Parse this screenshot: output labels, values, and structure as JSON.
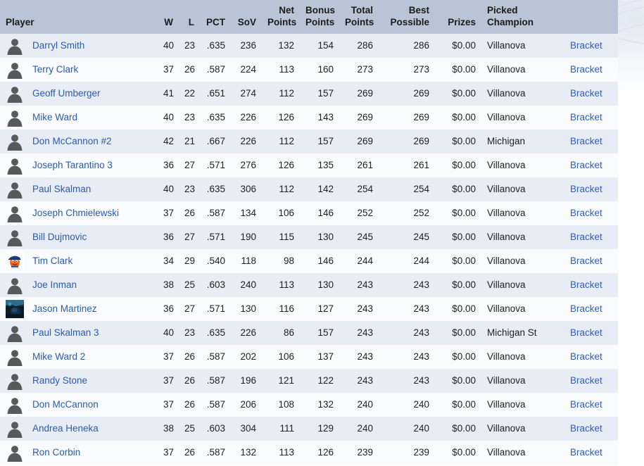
{
  "table": {
    "columns": [
      {
        "key": "player",
        "label": "Player",
        "align": "left"
      },
      {
        "key": "w",
        "label": "W",
        "align": "right"
      },
      {
        "key": "l",
        "label": "L",
        "align": "right"
      },
      {
        "key": "pct",
        "label": "PCT",
        "align": "right"
      },
      {
        "key": "sov",
        "label": "SoV",
        "align": "right"
      },
      {
        "key": "net_points",
        "label": "Net Points",
        "align": "right"
      },
      {
        "key": "bonus_points",
        "label": "Bonus Points",
        "align": "right"
      },
      {
        "key": "total_points",
        "label": "Total Points",
        "align": "right"
      },
      {
        "key": "best_possible",
        "label": "Best Possible",
        "align": "right"
      },
      {
        "key": "prizes",
        "label": "Prizes",
        "align": "right"
      },
      {
        "key": "picked_champion",
        "label": "Picked Champion",
        "align": "left"
      },
      {
        "key": "bracket",
        "label": "",
        "align": "left"
      }
    ],
    "bracket_link_label": "Bracket",
    "rows": [
      {
        "avatar": "default-avatar-icon",
        "player": "Darryl Smith",
        "w": "40",
        "l": "23",
        "pct": ".635",
        "sov": "236",
        "net_points": "132",
        "bonus_points": "154",
        "total_points": "286",
        "best_possible": "286",
        "prizes": "$0.00",
        "picked_champion": "Villanova",
        "bracket": "Bracket"
      },
      {
        "avatar": "default-avatar-icon",
        "player": "Terry Clark",
        "w": "37",
        "l": "26",
        "pct": ".587",
        "sov": "224",
        "net_points": "113",
        "bonus_points": "160",
        "total_points": "273",
        "best_possible": "273",
        "prizes": "$0.00",
        "picked_champion": "Villanova",
        "bracket": "Bracket"
      },
      {
        "avatar": "default-avatar-icon",
        "player": "Geoff Umberger",
        "w": "41",
        "l": "22",
        "pct": ".651",
        "sov": "274",
        "net_points": "112",
        "bonus_points": "157",
        "total_points": "269",
        "best_possible": "269",
        "prizes": "$0.00",
        "picked_champion": "Villanova",
        "bracket": "Bracket"
      },
      {
        "avatar": "default-avatar-icon",
        "player": "Mike Ward",
        "w": "40",
        "l": "23",
        "pct": ".635",
        "sov": "226",
        "net_points": "126",
        "bonus_points": "143",
        "total_points": "269",
        "best_possible": "269",
        "prizes": "$0.00",
        "picked_champion": "Villanova",
        "bracket": "Bracket"
      },
      {
        "avatar": "default-avatar-icon",
        "player": "Don McCannon #2",
        "w": "42",
        "l": "21",
        "pct": ".667",
        "sov": "226",
        "net_points": "112",
        "bonus_points": "157",
        "total_points": "269",
        "best_possible": "269",
        "prizes": "$0.00",
        "picked_champion": "Michigan",
        "bracket": "Bracket"
      },
      {
        "avatar": "default-avatar-icon",
        "player": "Joseph Tarantino 3",
        "w": "36",
        "l": "27",
        "pct": ".571",
        "sov": "276",
        "net_points": "126",
        "bonus_points": "135",
        "total_points": "261",
        "best_possible": "261",
        "prizes": "$0.00",
        "picked_champion": "Villanova",
        "bracket": "Bracket"
      },
      {
        "avatar": "default-avatar-icon",
        "player": "Paul Skalman",
        "w": "40",
        "l": "23",
        "pct": ".635",
        "sov": "306",
        "net_points": "112",
        "bonus_points": "142",
        "total_points": "254",
        "best_possible": "254",
        "prizes": "$0.00",
        "picked_champion": "Villanova",
        "bracket": "Bracket"
      },
      {
        "avatar": "default-avatar-icon",
        "player": "Joseph Chmielewski",
        "w": "37",
        "l": "26",
        "pct": ".587",
        "sov": "134",
        "net_points": "106",
        "bonus_points": "146",
        "total_points": "252",
        "best_possible": "252",
        "prizes": "$0.00",
        "picked_champion": "Villanova",
        "bracket": "Bracket"
      },
      {
        "avatar": "default-avatar-icon",
        "player": "Bill Dujmovic",
        "w": "36",
        "l": "27",
        "pct": ".571",
        "sov": "190",
        "net_points": "115",
        "bonus_points": "130",
        "total_points": "245",
        "best_possible": "245",
        "prizes": "$0.00",
        "picked_champion": "Villanova",
        "bracket": "Bracket"
      },
      {
        "avatar": "mascot-avatar-icon",
        "player": "Tim Clark",
        "w": "34",
        "l": "29",
        "pct": ".540",
        "sov": "118",
        "net_points": "98",
        "bonus_points": "146",
        "total_points": "244",
        "best_possible": "244",
        "prizes": "$0.00",
        "picked_champion": "Villanova",
        "bracket": "Bracket"
      },
      {
        "avatar": "default-avatar-icon",
        "player": "Joe Inman",
        "w": "38",
        "l": "25",
        "pct": ".603",
        "sov": "240",
        "net_points": "113",
        "bonus_points": "130",
        "total_points": "243",
        "best_possible": "243",
        "prizes": "$0.00",
        "picked_champion": "Villanova",
        "bracket": "Bracket"
      },
      {
        "avatar": "photo-avatar-icon",
        "player": "Jason Martinez",
        "w": "36",
        "l": "27",
        "pct": ".571",
        "sov": "130",
        "net_points": "116",
        "bonus_points": "127",
        "total_points": "243",
        "best_possible": "243",
        "prizes": "$0.00",
        "picked_champion": "Villanova",
        "bracket": "Bracket"
      },
      {
        "avatar": "default-avatar-icon",
        "player": "Paul Skalman 3",
        "w": "40",
        "l": "23",
        "pct": ".635",
        "sov": "226",
        "net_points": "86",
        "bonus_points": "157",
        "total_points": "243",
        "best_possible": "243",
        "prizes": "$0.00",
        "picked_champion": "Michigan St",
        "bracket": "Bracket"
      },
      {
        "avatar": "default-avatar-icon",
        "player": "Mike Ward 2",
        "w": "37",
        "l": "26",
        "pct": ".587",
        "sov": "202",
        "net_points": "106",
        "bonus_points": "137",
        "total_points": "243",
        "best_possible": "243",
        "prizes": "$0.00",
        "picked_champion": "Villanova",
        "bracket": "Bracket"
      },
      {
        "avatar": "default-avatar-icon",
        "player": "Randy Stone",
        "w": "37",
        "l": "26",
        "pct": ".587",
        "sov": "196",
        "net_points": "121",
        "bonus_points": "122",
        "total_points": "243",
        "best_possible": "243",
        "prizes": "$0.00",
        "picked_champion": "Villanova",
        "bracket": "Bracket"
      },
      {
        "avatar": "default-avatar-icon",
        "player": "Don McCannon",
        "w": "37",
        "l": "26",
        "pct": ".587",
        "sov": "206",
        "net_points": "108",
        "bonus_points": "132",
        "total_points": "240",
        "best_possible": "240",
        "prizes": "$0.00",
        "picked_champion": "Villanova",
        "bracket": "Bracket"
      },
      {
        "avatar": "default-avatar-icon",
        "player": "Andrea Heneka",
        "w": "38",
        "l": "25",
        "pct": ".603",
        "sov": "304",
        "net_points": "111",
        "bonus_points": "129",
        "total_points": "240",
        "best_possible": "240",
        "prizes": "$0.00",
        "picked_champion": "Villanova",
        "bracket": "Bracket"
      },
      {
        "avatar": "default-avatar-icon",
        "player": "Ron Corbin",
        "w": "37",
        "l": "26",
        "pct": ".587",
        "sov": "132",
        "net_points": "113",
        "bonus_points": "126",
        "total_points": "239",
        "best_possible": "239",
        "prizes": "$0.00",
        "picked_champion": "Villanova",
        "bracket": "Bracket"
      }
    ]
  },
  "colors": {
    "header_bg": "#b9c5d6",
    "row_odd_bg": "#e8ecf5",
    "row_even_bg": "#fafbfd",
    "link": "#2b5fc4",
    "player_link": "#2a5caa",
    "text": "#1f1f1f"
  }
}
